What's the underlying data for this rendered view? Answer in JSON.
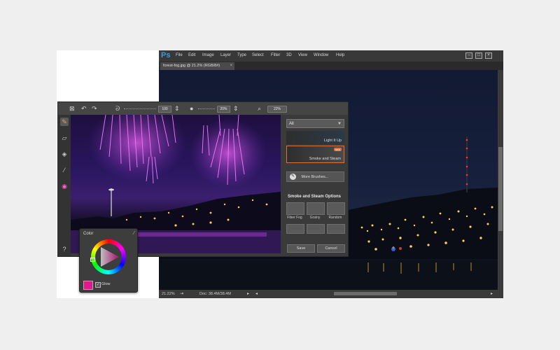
{
  "photoshop": {
    "logo": "Ps",
    "menu": [
      "File",
      "Edit",
      "Image",
      "Layer",
      "Type",
      "Select",
      "Filter",
      "3D",
      "View",
      "Window",
      "Help"
    ],
    "tab_title": "forest-fog.jpg @ 21.2% (RGB/8#)",
    "tab_close": "×",
    "status_zoom": "21.22%",
    "status_doc": "Doc: 38.4M/38.4M"
  },
  "plugin": {
    "brush_size_value": "100",
    "opacity_value": "20%",
    "zoom_value": "22%",
    "brush_category": "All",
    "brushes": [
      {
        "label": "Light It Up"
      },
      {
        "label": "Smoke and Steam",
        "badge": "new"
      }
    ],
    "more_brushes_label": "More Brushes...",
    "options_title": "Smoke and Steam Options",
    "options": [
      "Fiber Fog",
      "Grainy",
      "Random"
    ],
    "save_label": "Save",
    "cancel_label": "Cancel"
  },
  "color_panel": {
    "title": "Color",
    "glow_label": "Glow",
    "glow_checked": true,
    "current_color": "#e0188f"
  },
  "colors": {
    "accent_ps": "#3d9bd8",
    "firework_magenta": "#e040ff"
  }
}
